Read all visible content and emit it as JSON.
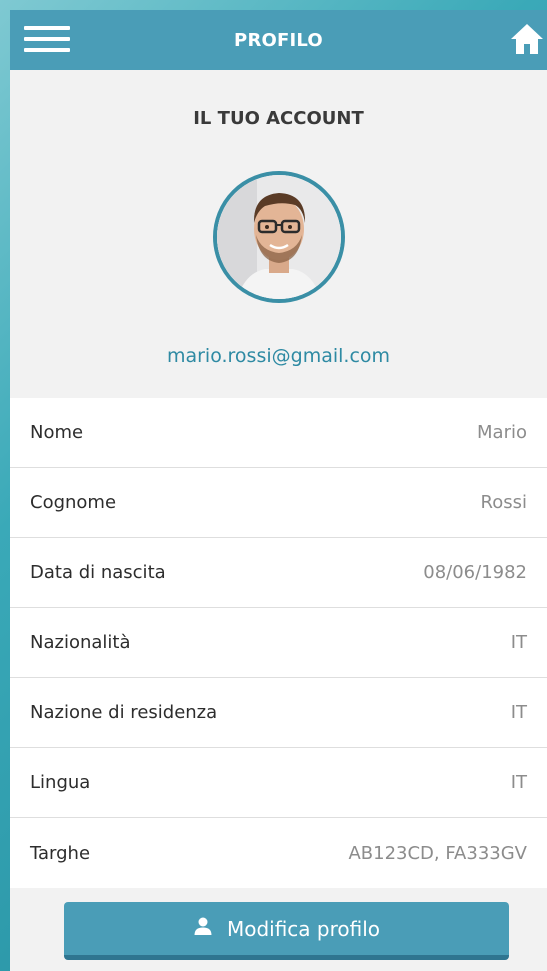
{
  "header": {
    "title": "PROFILO",
    "menu_icon": "hamburger-menu-icon",
    "home_icon": "home-icon"
  },
  "account": {
    "title": "IL TUO ACCOUNT",
    "email": "mario.rossi@gmail.com"
  },
  "details": [
    {
      "label": "Nome",
      "value": "Mario"
    },
    {
      "label": "Cognome",
      "value": "Rossi"
    },
    {
      "label": "Data di nascita",
      "value": "08/06/1982"
    },
    {
      "label": "Nazionalità",
      "value": "IT"
    },
    {
      "label": "Nazione di residenza",
      "value": "IT"
    },
    {
      "label": "Lingua",
      "value": "IT"
    },
    {
      "label": "Targhe",
      "value": "AB123CD, FA333GV"
    }
  ],
  "actions": {
    "edit_label": "Modifica profilo",
    "edit_icon": "user-icon"
  },
  "colors": {
    "primary": "#4a9db7",
    "primary_dark": "#2f7590",
    "email_link": "#2e8aa3",
    "value_text": "#8c8c8c"
  }
}
